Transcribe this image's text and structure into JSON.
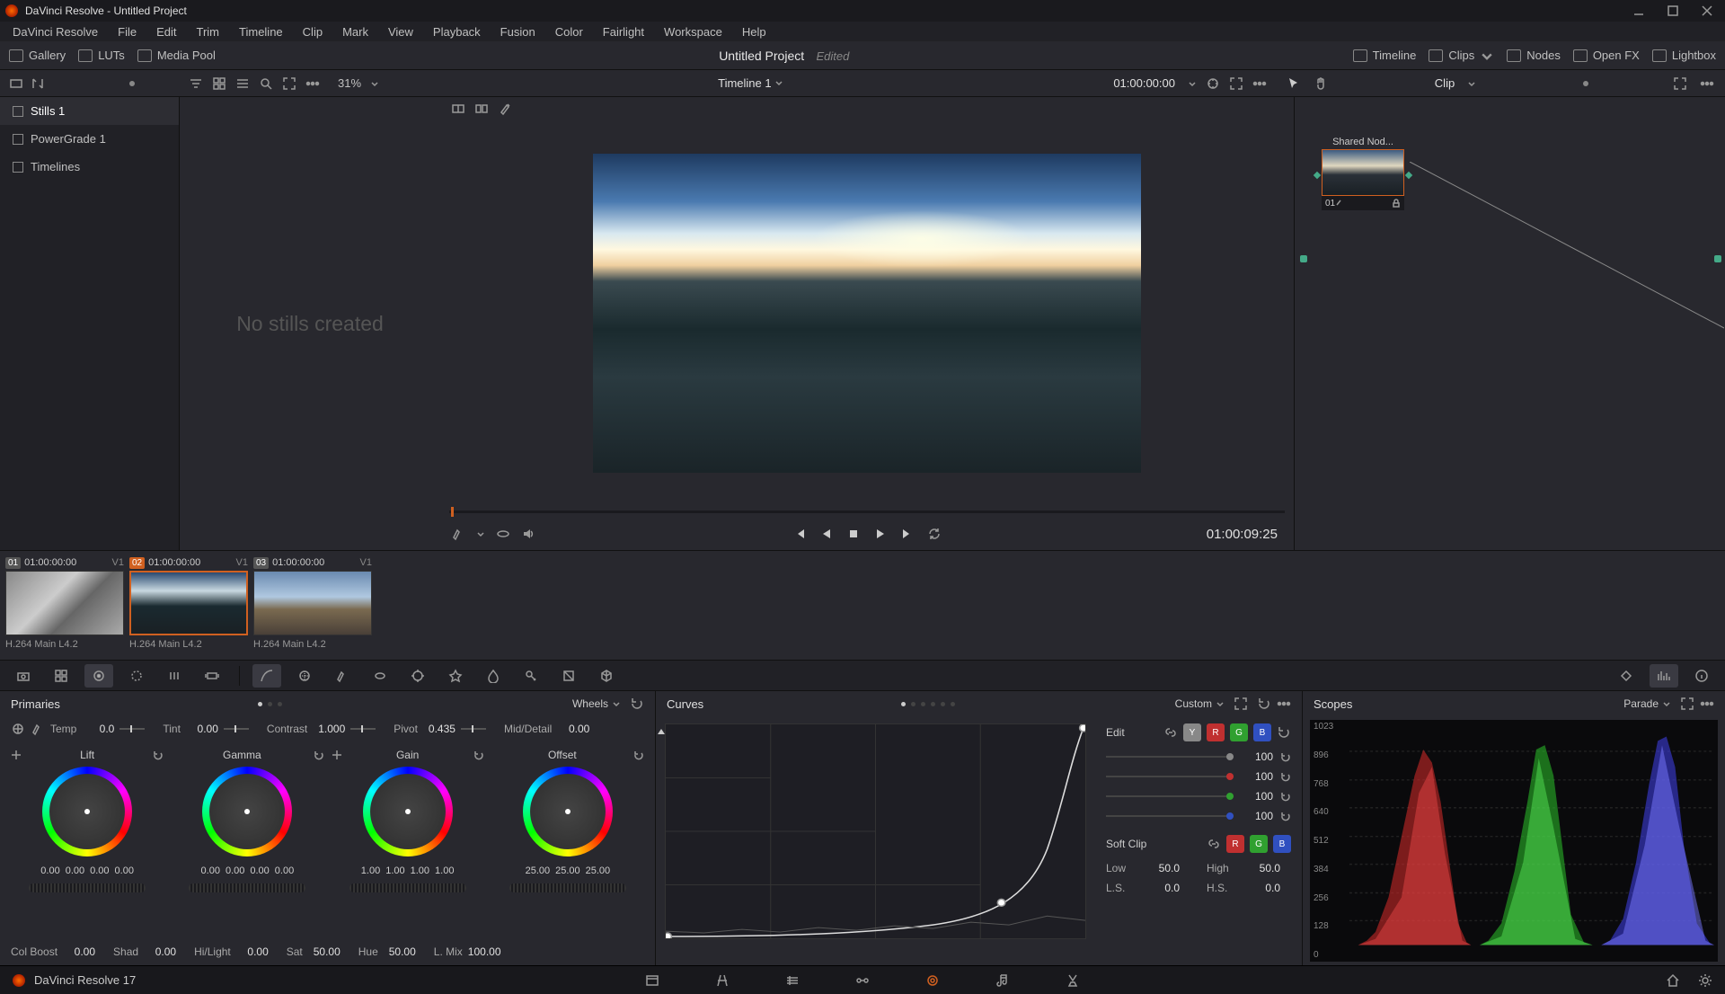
{
  "window": {
    "title": "DaVinci Resolve - Untitled Project"
  },
  "menu": [
    "DaVinci Resolve",
    "File",
    "Edit",
    "Trim",
    "Timeline",
    "Clip",
    "Mark",
    "View",
    "Playback",
    "Fusion",
    "Color",
    "Fairlight",
    "Workspace",
    "Help"
  ],
  "toolbar": {
    "gallery": "Gallery",
    "luts": "LUTs",
    "mediapool": "Media Pool",
    "project": "Untitled Project",
    "status": "Edited",
    "timeline_btn": "Timeline",
    "clips_btn": "Clips",
    "nodes_btn": "Nodes",
    "openfx": "Open FX",
    "lightbox": "Lightbox"
  },
  "secbar": {
    "zoom": "31%",
    "timeline_name": "Timeline 1",
    "timecode": "01:00:00:00",
    "clip_mode": "Clip"
  },
  "gallery_tabs": [
    "Stills 1",
    "PowerGrade 1",
    "Timelines"
  ],
  "stills_empty": "No stills created",
  "viewer": {
    "timecode": "01:00:09:25"
  },
  "node": {
    "label": "Shared Nod...",
    "num": "01"
  },
  "clips": [
    {
      "num": "01",
      "tc": "01:00:00:00",
      "track": "V1",
      "name": "H.264 Main L4.2",
      "sel": false
    },
    {
      "num": "02",
      "tc": "01:00:00:00",
      "track": "V1",
      "name": "H.264 Main L4.2",
      "sel": true
    },
    {
      "num": "03",
      "tc": "01:00:00:00",
      "track": "V1",
      "name": "H.264 Main L4.2",
      "sel": false
    }
  ],
  "primaries": {
    "title": "Primaries",
    "mode": "Wheels",
    "temp": {
      "label": "Temp",
      "val": "0.0"
    },
    "tint": {
      "label": "Tint",
      "val": "0.00"
    },
    "contrast": {
      "label": "Contrast",
      "val": "1.000"
    },
    "pivot": {
      "label": "Pivot",
      "val": "0.435"
    },
    "middetail": {
      "label": "Mid/Detail",
      "val": "0.00"
    },
    "wheels": [
      {
        "name": "Lift",
        "nums": [
          "0.00",
          "0.00",
          "0.00",
          "0.00"
        ]
      },
      {
        "name": "Gamma",
        "nums": [
          "0.00",
          "0.00",
          "0.00",
          "0.00"
        ]
      },
      {
        "name": "Gain",
        "nums": [
          "1.00",
          "1.00",
          "1.00",
          "1.00"
        ]
      },
      {
        "name": "Offset",
        "nums": [
          "25.00",
          "25.00",
          "25.00"
        ]
      }
    ],
    "colboost": {
      "label": "Col Boost",
      "val": "0.00"
    },
    "shad": {
      "label": "Shad",
      "val": "0.00"
    },
    "hilight": {
      "label": "Hi/Light",
      "val": "0.00"
    },
    "sat": {
      "label": "Sat",
      "val": "50.00"
    },
    "hue": {
      "label": "Hue",
      "val": "50.00"
    },
    "lmix": {
      "label": "L. Mix",
      "val": "100.00"
    }
  },
  "curves": {
    "title": "Curves",
    "mode": "Custom",
    "edit_label": "Edit",
    "channels": [
      {
        "color": "#888",
        "val": "100"
      },
      {
        "color": "#c03030",
        "val": "100"
      },
      {
        "color": "#30a030",
        "val": "100"
      },
      {
        "color": "#3050c0",
        "val": "100"
      }
    ],
    "softclip_label": "Soft Clip",
    "low": {
      "label": "Low",
      "val": "50.0"
    },
    "high": {
      "label": "High",
      "val": "50.0"
    },
    "ls": {
      "label": "L.S.",
      "val": "0.0"
    },
    "hs": {
      "label": "H.S.",
      "val": "0.0"
    }
  },
  "scopes": {
    "title": "Scopes",
    "mode": "Parade",
    "ticks": [
      "1023",
      "896",
      "768",
      "640",
      "512",
      "384",
      "256",
      "128",
      "0"
    ]
  },
  "statusbar": {
    "version": "DaVinci Resolve 17"
  }
}
